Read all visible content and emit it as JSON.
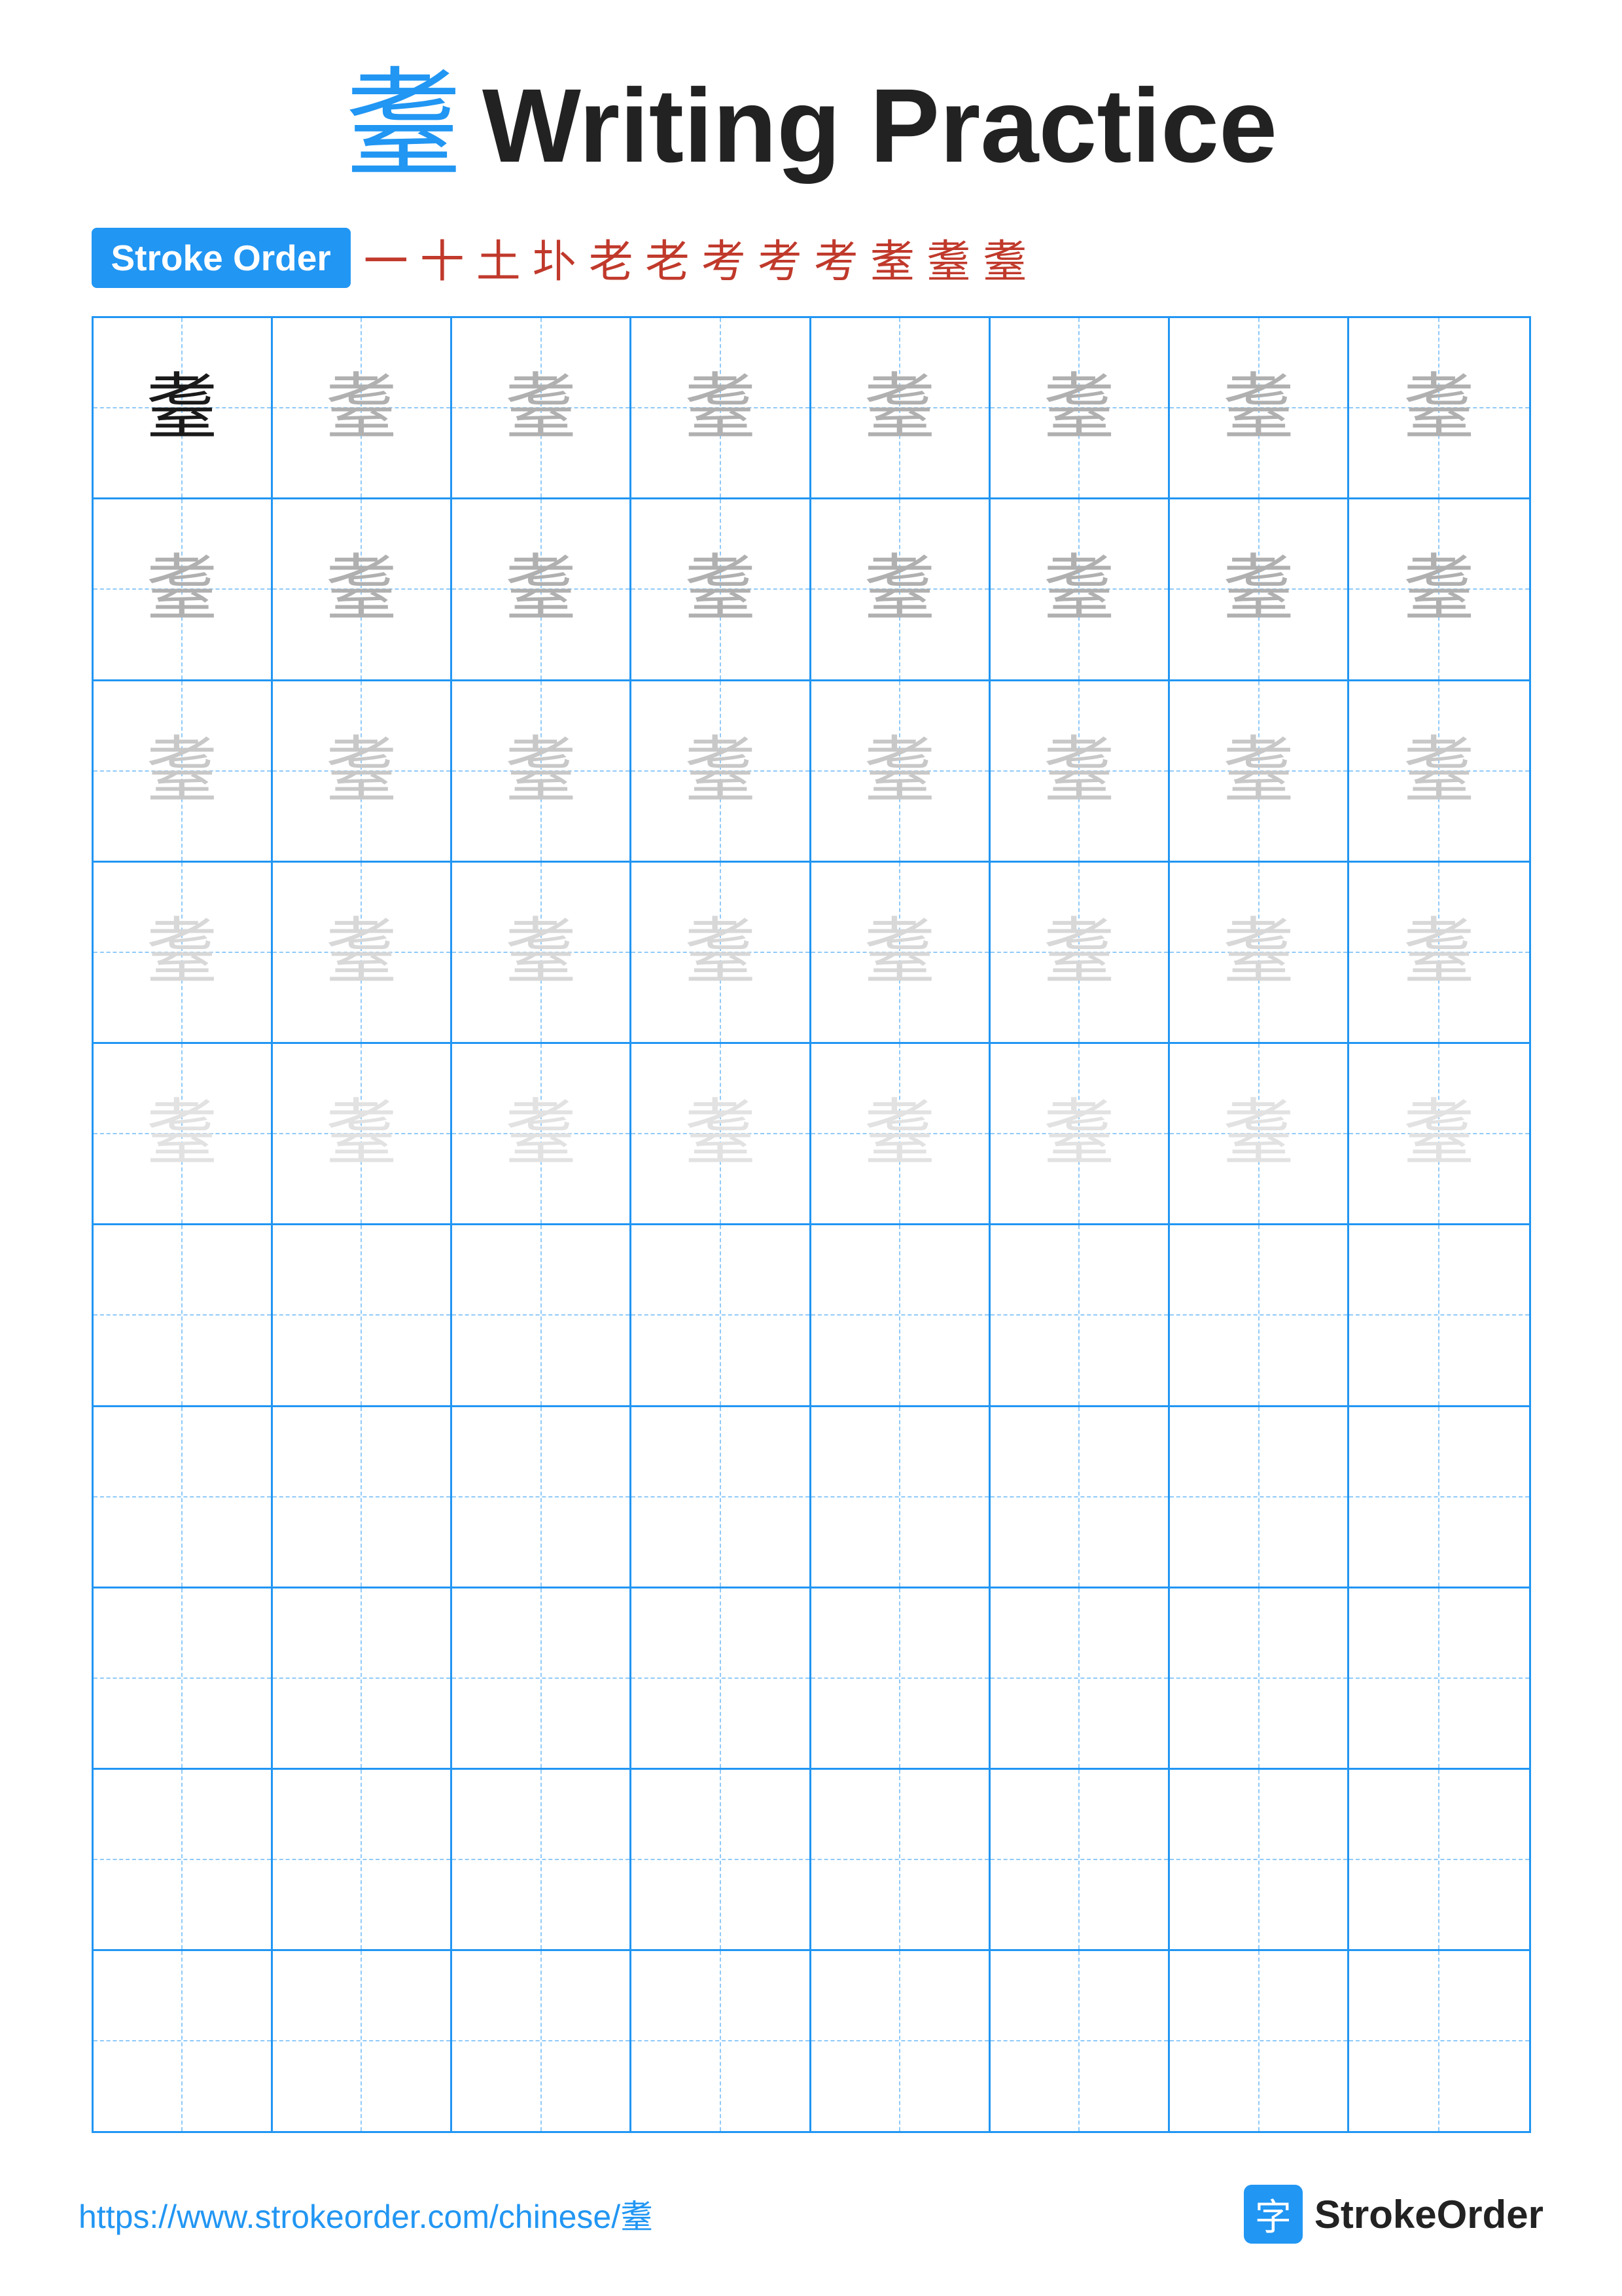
{
  "title": {
    "char": "耋",
    "label": "Writing Practice"
  },
  "stroke_order": {
    "badge_label": "Stroke Order",
    "steps": [
      "一",
      "十",
      "土",
      "圤",
      "老",
      "老",
      "考",
      "考",
      "考",
      "耊",
      "耋",
      "耋"
    ]
  },
  "grid": {
    "rows": [
      {
        "type": "mixed",
        "cells": [
          "dark",
          "gray1",
          "gray1",
          "gray1",
          "gray1",
          "gray1",
          "gray1",
          "gray1"
        ]
      },
      {
        "type": "gray1",
        "cells": [
          "gray1",
          "gray1",
          "gray1",
          "gray1",
          "gray1",
          "gray1",
          "gray1",
          "gray1"
        ]
      },
      {
        "type": "gray2",
        "cells": [
          "gray2",
          "gray2",
          "gray2",
          "gray2",
          "gray2",
          "gray2",
          "gray2",
          "gray2"
        ]
      },
      {
        "type": "gray3",
        "cells": [
          "gray3",
          "gray3",
          "gray3",
          "gray3",
          "gray3",
          "gray3",
          "gray3",
          "gray3"
        ]
      },
      {
        "type": "gray4",
        "cells": [
          "gray4",
          "gray4",
          "gray4",
          "gray4",
          "gray4",
          "gray4",
          "gray4",
          "gray4"
        ]
      },
      {
        "type": "empty"
      },
      {
        "type": "empty"
      },
      {
        "type": "empty"
      },
      {
        "type": "empty"
      },
      {
        "type": "empty"
      }
    ],
    "char": "耋"
  },
  "footer": {
    "url": "https://www.strokeorder.com/chinese/耋",
    "brand_char": "字",
    "brand_name": "StrokeOrder"
  }
}
